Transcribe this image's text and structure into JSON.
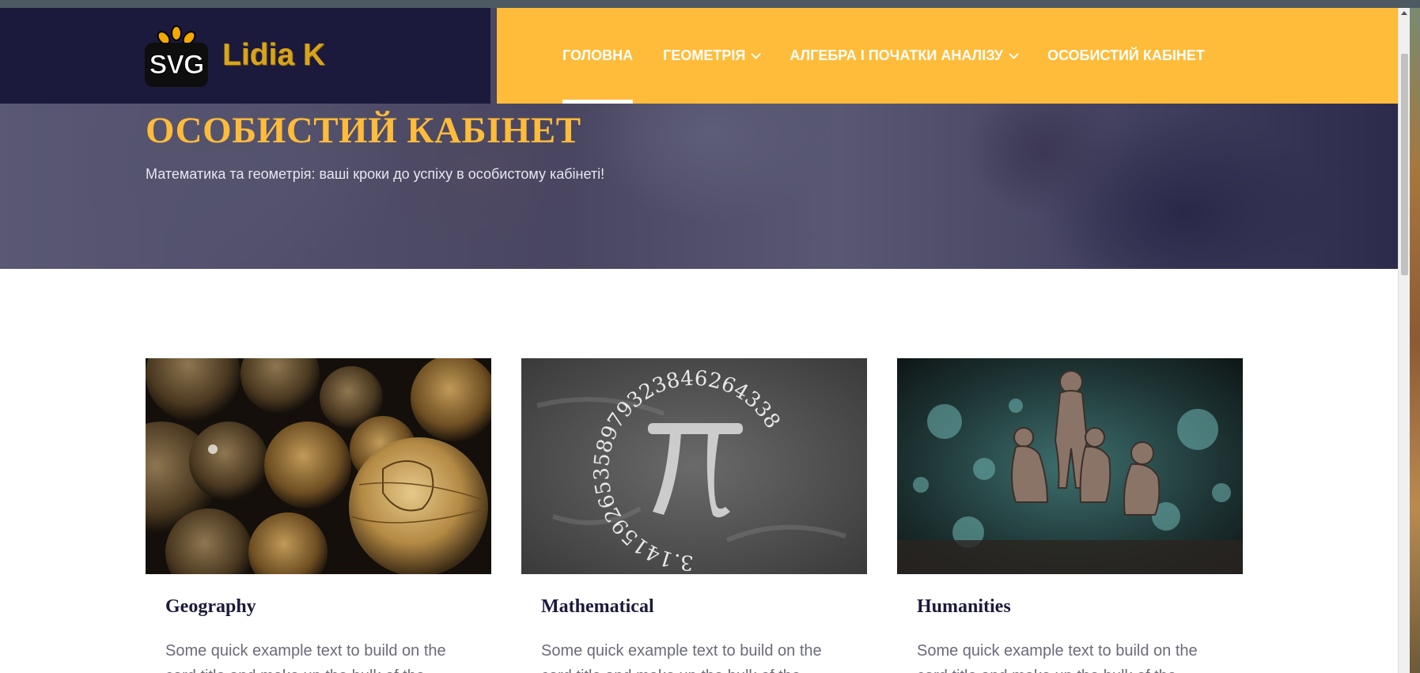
{
  "brand": {
    "logo_badge_text": "SVG",
    "name": "Lidia K"
  },
  "nav": {
    "items": [
      {
        "label": "ГОЛОВНА",
        "active": true,
        "dropdown": false
      },
      {
        "label": "ГЕОМЕТРІЯ",
        "active": false,
        "dropdown": true
      },
      {
        "label": "АЛГЕБРА І ПОЧАТКИ АНАЛІЗУ",
        "active": false,
        "dropdown": true
      },
      {
        "label": "ОСОБИСТИЙ КАБІНЕТ",
        "active": false,
        "dropdown": false
      }
    ]
  },
  "hero": {
    "title": "ОСОБИСТИЙ КАБІНЕТ",
    "subtitle": "Математика та геометрія: ваші кроки до успіху в особистому кабінеті!"
  },
  "cards": [
    {
      "title": "Geography",
      "text": "Some quick example text to build on the card title and make up the bulk of the",
      "image": "globes"
    },
    {
      "title": "Mathematical",
      "text": "Some quick example text to build on the card title and make up the bulk of the",
      "image": "pi-chalkboard"
    },
    {
      "title": "Humanities",
      "text": "Some quick example text to build on the card title and make up the bulk of the",
      "image": "sculpture-figures"
    }
  ],
  "pi_digits": "3.14159265358979323846264338",
  "colors": {
    "accent": "#ffbc3a",
    "navy": "#1b1a3c",
    "brand_gold": "#d9a41d"
  }
}
